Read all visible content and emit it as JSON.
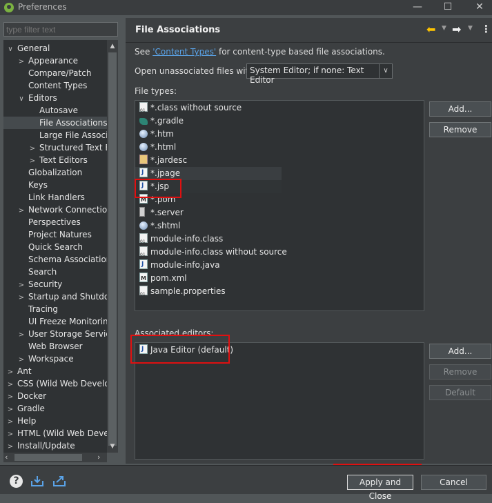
{
  "window": {
    "title": "Preferences",
    "minimize": "—",
    "maximize": "☐",
    "close": "✕"
  },
  "filter": {
    "placeholder": "type filter text"
  },
  "tree": {
    "rows": [
      {
        "label": "General",
        "twisty": "∨"
      },
      {
        "label": "Appearance",
        "twisty": ">"
      },
      {
        "label": "Compare/Patch",
        "twisty": ""
      },
      {
        "label": "Content Types",
        "twisty": ""
      },
      {
        "label": "Editors",
        "twisty": "∨"
      },
      {
        "label": "Autosave",
        "twisty": ""
      },
      {
        "label": "File Associations",
        "twisty": ""
      },
      {
        "label": "Large File Associati",
        "twisty": ""
      },
      {
        "label": "Structured Text Ec",
        "twisty": ">"
      },
      {
        "label": "Text Editors",
        "twisty": ">"
      },
      {
        "label": "Globalization",
        "twisty": ""
      },
      {
        "label": "Keys",
        "twisty": ""
      },
      {
        "label": "Link Handlers",
        "twisty": ""
      },
      {
        "label": "Network Connection",
        "twisty": ">"
      },
      {
        "label": "Perspectives",
        "twisty": ""
      },
      {
        "label": "Project Natures",
        "twisty": ""
      },
      {
        "label": "Quick Search",
        "twisty": ""
      },
      {
        "label": "Schema Associations",
        "twisty": ""
      },
      {
        "label": "Search",
        "twisty": ""
      },
      {
        "label": "Security",
        "twisty": ">"
      },
      {
        "label": "Startup and Shutdow",
        "twisty": ">"
      },
      {
        "label": "Tracing",
        "twisty": ""
      },
      {
        "label": "UI Freeze Monitoring",
        "twisty": ""
      },
      {
        "label": "User Storage Service",
        "twisty": ">"
      },
      {
        "label": "Web Browser",
        "twisty": ""
      },
      {
        "label": "Workspace",
        "twisty": ">"
      },
      {
        "label": "Ant",
        "twisty": ">"
      },
      {
        "label": "CSS (Wild Web Develop",
        "twisty": ">"
      },
      {
        "label": "Docker",
        "twisty": ">"
      },
      {
        "label": "Gradle",
        "twisty": ">"
      },
      {
        "label": "Help",
        "twisty": ">"
      },
      {
        "label": "HTML (Wild Web Develo",
        "twisty": ">"
      },
      {
        "label": "Install/Update",
        "twisty": ">"
      }
    ]
  },
  "page": {
    "title": "File Associations",
    "see_prefix": "See ",
    "see_link": "'Content Types'",
    "see_suffix": " for content-type based file associations.",
    "open_label": "Open unassociated files with:",
    "open_value": "System Editor; if none: Text Editor",
    "file_types_label": "File types:",
    "file_types": [
      {
        "label": "*.class without source",
        "icon": "class-file-icon"
      },
      {
        "label": "*.gradle",
        "icon": "gradle-icon"
      },
      {
        "label": "*.htm",
        "icon": "globe-icon"
      },
      {
        "label": "*.html",
        "icon": "globe-icon"
      },
      {
        "label": "*.jardesc",
        "icon": "jar-icon"
      },
      {
        "label": "*.jpage",
        "icon": "java-file-icon"
      },
      {
        "label": "*.jsp",
        "icon": "java-file-icon"
      },
      {
        "label": "*.pom",
        "icon": "maven-icon"
      },
      {
        "label": "*.server",
        "icon": "server-icon"
      },
      {
        "label": "*.shtml",
        "icon": "globe-icon"
      },
      {
        "label": "module-info.class",
        "icon": "class-file-icon"
      },
      {
        "label": "module-info.class without source",
        "icon": "class-file-icon"
      },
      {
        "label": "module-info.java",
        "icon": "java-file-icon"
      },
      {
        "label": "pom.xml",
        "icon": "maven-icon"
      },
      {
        "label": "sample.properties",
        "icon": "properties-file-icon"
      }
    ],
    "add_label": "Add...",
    "remove_label": "Remove",
    "assoc_label": "Associated editors:",
    "assoc_editors": [
      {
        "label": "Java Editor (default)",
        "icon": "java-file-icon"
      }
    ],
    "assoc_add_label": "Add...",
    "assoc_remove_label": "Remove",
    "assoc_default_label": "Default"
  },
  "footer": {
    "help_label": "?",
    "apply_close_label": "Apply and Close",
    "cancel_label": "Cancel"
  },
  "colors": {
    "accent_link": "#5aa3e8",
    "highlight_box": "#e01010",
    "nav_arrow": "#ffc400"
  }
}
